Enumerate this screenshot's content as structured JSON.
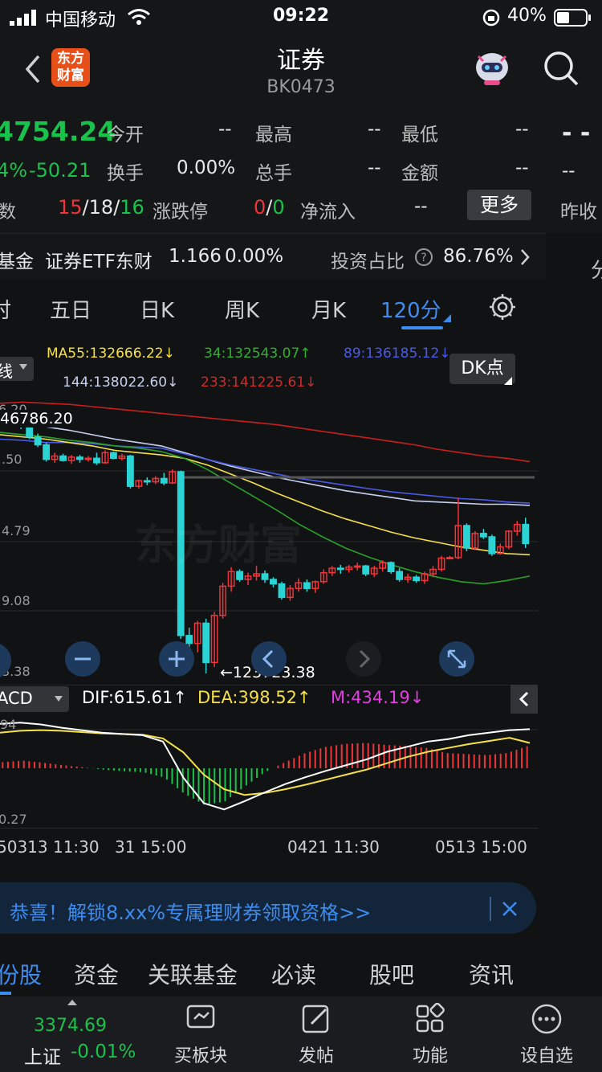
{
  "status_bar": {
    "carrier": "中国移动",
    "time": "09:22",
    "battery": "40%"
  },
  "nav": {
    "title": "证券",
    "code": "BK0473",
    "logo_text": "东方\n财富"
  },
  "quote": {
    "price": "4754.24",
    "change_pct": "4%",
    "change": "-50.21",
    "count_label": "家数",
    "up": "15",
    "flat": "18",
    "down": "16",
    "limit_label": "涨跌停",
    "limit_up": "0",
    "limit_down": "0",
    "open_label": "今开",
    "open": "--",
    "high_label": "最高",
    "high": "--",
    "low_label": "最低",
    "low": "--",
    "turnover_label": "换手",
    "turnover": "0.00%",
    "volume_label": "总手",
    "volume": "--",
    "amount_label": "金额",
    "amount": "--",
    "netflow_label": "净流入",
    "netflow": "--",
    "more_btn": "更多",
    "right_top": "- -",
    "right_mid": "--",
    "right_bottom": "昨收"
  },
  "fund": {
    "label": "基金",
    "name": "证券ETF东财",
    "price": "1.166",
    "change": "0.00%",
    "ratio_label": "投资占比",
    "ratio": "86.76%",
    "side_text": "分"
  },
  "tabs": [
    "时",
    "五日",
    "日K",
    "周K",
    "月K",
    "120分"
  ],
  "active_tab": "120分",
  "ma": {
    "type_label": "线",
    "ma55": "MA55:132666.22",
    "ma34": "34:132543.07",
    "ma89": "89:136185.12",
    "ma144": "144:138022.60",
    "ma233": "233:141225.61",
    "dk_btn": "DK点"
  },
  "axis": {
    "p1": "6.20",
    "p1_full": "46786.20",
    "p2": ".50",
    "p3": "4.79",
    "p4": "9.08",
    "p5": "3.38",
    "low_marker": "←123723.38"
  },
  "macd": {
    "type_label": "ACD",
    "dif": "DIF:615.61",
    "dea": "DEA:398.52",
    "m": "M:434.19",
    "axis_top": "94",
    "axis_bottom": "0.27"
  },
  "dates": [
    "50313 11:30",
    "31 15:00",
    "0421 11:30",
    "0513 15:00"
  ],
  "banner": {
    "text": "恭喜！解锁8.xx%专属理财券领取资格>>"
  },
  "subtabs": [
    "份股",
    "资金",
    "关联基金",
    "必读",
    "股吧",
    "资讯"
  ],
  "bottom": {
    "index_value": "3374.69",
    "index_name": "上证",
    "index_change": "-0.01%",
    "items": [
      "买板块",
      "发帖",
      "功能",
      "设自选"
    ]
  },
  "colors": {
    "up": "#f0343a",
    "down": "#19c24a",
    "accent": "#3d8cf0",
    "ma55": "#f5e04a",
    "ma34": "#2aa02a",
    "ma89": "#4a5ae8",
    "ma144": "#c8d0f0",
    "ma233": "#c81e1e"
  },
  "chart_data": {
    "type": "candlestick",
    "candles": [
      [
        146500,
        146700,
        145900,
        146300
      ],
      [
        146300,
        146786,
        145800,
        145950
      ],
      [
        145950,
        146200,
        145500,
        145700
      ],
      [
        145700,
        145900,
        144600,
        144800
      ],
      [
        144800,
        145100,
        143900,
        144100
      ],
      [
        144100,
        144300,
        142600,
        142800
      ],
      [
        142800,
        143400,
        142500,
        143100
      ],
      [
        143100,
        143300,
        142600,
        142700
      ],
      [
        142700,
        143200,
        142400,
        143000
      ],
      [
        143000,
        143200,
        142500,
        142800
      ],
      [
        142800,
        143100,
        142600,
        142900
      ],
      [
        142900,
        143400,
        142300,
        142500
      ],
      [
        142500,
        143600,
        142400,
        143400
      ],
      [
        143400,
        143500,
        142800,
        142900
      ],
      [
        142900,
        143300,
        142700,
        143100
      ],
      [
        143100,
        143200,
        140200,
        140400
      ],
      [
        140400,
        141000,
        140200,
        140900
      ],
      [
        140900,
        141200,
        140500,
        140800
      ],
      [
        140800,
        141300,
        140600,
        141100
      ],
      [
        141100,
        141600,
        140500,
        140700
      ],
      [
        140700,
        141900,
        140600,
        141700
      ],
      [
        141700,
        141800,
        126800,
        127100
      ],
      [
        127100,
        127800,
        126000,
        126400
      ],
      [
        126400,
        128400,
        125600,
        128200
      ],
      [
        128200,
        128600,
        123723,
        124700
      ],
      [
        124700,
        129200,
        124300,
        128900
      ],
      [
        128900,
        131800,
        128600,
        131500
      ],
      [
        131500,
        133200,
        131000,
        132800
      ],
      [
        132800,
        133000,
        131900,
        132100
      ],
      [
        132100,
        132700,
        131600,
        132400
      ],
      [
        132400,
        133300,
        132000,
        132600
      ],
      [
        132600,
        132900,
        131800,
        132100
      ],
      [
        132100,
        132300,
        131400,
        131700
      ],
      [
        131700,
        131900,
        130300,
        130500
      ],
      [
        130500,
        131600,
        130200,
        131300
      ],
      [
        131300,
        132200,
        131000,
        131800
      ],
      [
        131800,
        132100,
        131000,
        131300
      ],
      [
        131300,
        132000,
        130900,
        131900
      ],
      [
        131900,
        133000,
        131700,
        132700
      ],
      [
        132700,
        133300,
        132400,
        133100
      ],
      [
        133100,
        133400,
        132600,
        133000
      ],
      [
        133000,
        133400,
        132700,
        133200
      ],
      [
        133200,
        133600,
        132900,
        133300
      ],
      [
        133300,
        133400,
        132400,
        132600
      ],
      [
        132600,
        133300,
        132300,
        133100
      ],
      [
        133100,
        133800,
        132800,
        133600
      ],
      [
        133600,
        133700,
        132600,
        132800
      ],
      [
        132800,
        133100,
        131900,
        132100
      ],
      [
        132100,
        132600,
        131800,
        132300
      ],
      [
        132300,
        132500,
        131800,
        132000
      ],
      [
        132000,
        132800,
        131700,
        132600
      ],
      [
        132600,
        133300,
        132300,
        133000
      ],
      [
        133000,
        134200,
        132800,
        134000
      ],
      [
        134000,
        134200,
        133900,
        134050
      ],
      [
        134050,
        139400,
        133900,
        136900
      ],
      [
        136900,
        137100,
        134600,
        134900
      ],
      [
        134900,
        136400,
        134700,
        136200
      ],
      [
        136200,
        136600,
        135700,
        135900
      ],
      [
        135900,
        136100,
        134200,
        134400
      ],
      [
        134400,
        135300,
        134300,
        135000
      ],
      [
        135000,
        136500,
        134800,
        136400
      ],
      [
        136400,
        137300,
        136000,
        137000
      ],
      [
        137000,
        137600,
        134900,
        135300
      ]
    ],
    "ma_lines": {
      "MA55": [
        145000,
        144800,
        144600,
        144300,
        144000,
        143600,
        143400,
        143200,
        142900,
        142300,
        141500,
        140700,
        139800,
        139000,
        138200,
        137500,
        136900,
        136300,
        135800,
        135400,
        135000,
        134700,
        134400,
        134300
      ],
      "MA34": [
        145200,
        145000,
        144800,
        144500,
        144300,
        144000,
        143800,
        143500,
        142900,
        141900,
        140700,
        139500,
        138300,
        137000,
        135900,
        134900,
        134100,
        133400,
        132800,
        132300,
        131900,
        131700,
        132000,
        132400
      ],
      "MA89": [
        144600,
        144500,
        144300,
        144300,
        144200,
        144000,
        143900,
        143800,
        143300,
        142800,
        142300,
        141900,
        141500,
        141100,
        140800,
        140500,
        140200,
        139900,
        139700,
        139500,
        139300,
        139200,
        139000,
        138900
      ],
      "MA144": [
        146300,
        146000,
        145700,
        145400,
        145000,
        144600,
        144300,
        144000,
        143400,
        142800,
        142200,
        141700,
        141200,
        140800,
        140400,
        140000,
        139700,
        139400,
        139100,
        139000,
        138900,
        138800,
        138800,
        138700
      ],
      "MA233": [
        147800,
        147900,
        147800,
        147700,
        147500,
        147300,
        147100,
        146900,
        146700,
        146500,
        146300,
        146100,
        145900,
        145600,
        145300,
        145000,
        144700,
        144400,
        144100,
        143700,
        143400,
        143100,
        142900,
        142600
      ]
    },
    "ylim": [
      123723.38,
      146786.2
    ],
    "macd": {
      "dif": [
        700,
        720,
        690,
        640,
        600,
        560,
        540,
        520,
        420,
        -150,
        -550,
        -650,
        -520,
        -380,
        -250,
        -140,
        -40,
        50,
        140,
        260,
        340,
        420,
        460,
        520,
        560,
        600,
        615.61
      ],
      "dea": [
        560,
        590,
        600,
        590,
        570,
        550,
        540,
        530,
        470,
        250,
        -100,
        -330,
        -420,
        -390,
        -330,
        -260,
        -180,
        -100,
        -20,
        80,
        180,
        260,
        320,
        380,
        430,
        480,
        398.52
      ],
      "m": [
        120,
        150,
        110,
        60,
        20,
        -30,
        -60,
        -80,
        -180,
        -500,
        -720,
        -660,
        -360,
        -80,
        120,
        300,
        420,
        480,
        500,
        460,
        440,
        400,
        300,
        280,
        260,
        300,
        434.19
      ]
    }
  }
}
